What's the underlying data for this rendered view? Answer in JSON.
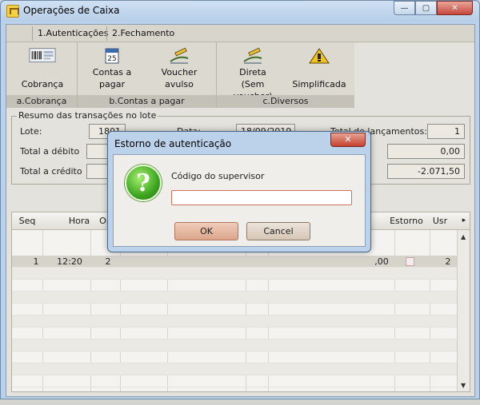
{
  "window": {
    "title": "Operações de Caixa",
    "min_glyph": "—",
    "max_glyph": "▢",
    "close_glyph": "✕"
  },
  "tabs": [
    {
      "label": "1.Autenticações"
    },
    {
      "label": "2.Fechamento"
    }
  ],
  "ribbon": {
    "buttons": [
      {
        "line1": "",
        "line2": "Cobrança",
        "icon": "barcode-icon"
      },
      {
        "line1": "Contas a",
        "line2": "pagar",
        "icon": "calendar-icon"
      },
      {
        "line1": "Voucher",
        "line2": "avulso",
        "icon": "pen-icon"
      },
      {
        "line1": "Direta",
        "line2": "(Sem voucher)",
        "icon": "pen-icon"
      },
      {
        "line1": "",
        "line2": "Simplificada",
        "icon": "warning-icon"
      }
    ],
    "groups": [
      {
        "label": "a.Cobrança"
      },
      {
        "label": "b.Contas a pagar"
      },
      {
        "label": "c.Diversos"
      }
    ]
  },
  "summary": {
    "title": "Resumo das transações no lote",
    "lote_label": "Lote:",
    "lote_value": "1801",
    "data_label": "Data:",
    "data_value": "18/09/2019",
    "total_lanc_label": "Total de lançamentos:",
    "total_lanc_value": "1",
    "total_debito_label": "Total a débito",
    "total_debito_value": "0,00",
    "total_credito_label": "Total a crédito",
    "total_credito_value": "-2.071,50"
  },
  "grid": {
    "headers": {
      "seq": "Seq",
      "hora": "Hora",
      "op": "Op",
      "estorno": "Estorno",
      "usr": "Usr"
    },
    "row": {
      "seq": "1",
      "hora": "12:20",
      "op": "2",
      "valor_frag": ",00",
      "usr": "2"
    },
    "scroll_up": "▲",
    "scroll_down": "▼",
    "scroll_right": "▸"
  },
  "dialog": {
    "title": "Estorno de autenticação",
    "close_glyph": "✕",
    "question_glyph": "?",
    "label": "Código do supervisor",
    "input_value": "",
    "ok_label": "OK",
    "cancel_label": "Cancel"
  }
}
